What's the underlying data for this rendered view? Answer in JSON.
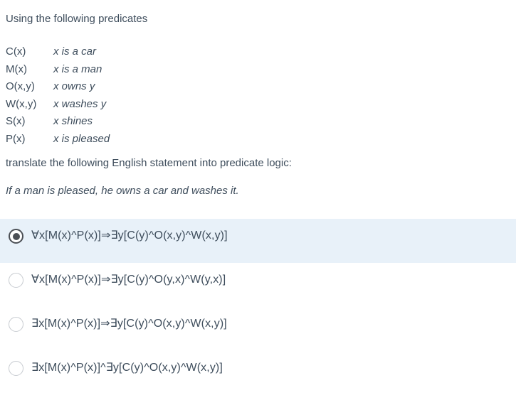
{
  "clipped_top_fragments": [
    "·",
    "·",
    "·",
    "·"
  ],
  "question": {
    "intro": "Using the following predicates",
    "instruction": "translate the following English statement into predicate logic:",
    "statement": "If a man is pleased, he owns a car and washes it."
  },
  "predicates": [
    {
      "symbol": "C(x)",
      "description": "x is a car"
    },
    {
      "symbol": "M(x)",
      "description": "x is a man"
    },
    {
      "symbol": "O(x,y)",
      "description": "x owns y"
    },
    {
      "symbol": "W(x,y)",
      "description": "x washes y"
    },
    {
      "symbol": "S(x)",
      "description": "x shines"
    },
    {
      "symbol": "P(x)",
      "description": "x is pleased"
    }
  ],
  "options": [
    {
      "text": "∀x[M(x)^P(x)]⇒∃y[C(y)^O(x,y)^W(x,y)]",
      "selected": true
    },
    {
      "text": "∀x[M(x)^P(x)]⇒∃y[C(y)^O(y,x)^W(y,x)]",
      "selected": false
    },
    {
      "text": "∃x[M(x)^P(x)]⇒∃y[C(y)^O(x,y)^W(x,y)]",
      "selected": false
    },
    {
      "text": "∃x[M(x)^P(x)]^∃y[C(y)^O(x,y)^W(x,y)]",
      "selected": false
    }
  ],
  "colors": {
    "page_background": "#ffffff",
    "text": "#3e4d5c",
    "selected_row_background": "#e8f1f9",
    "radio_unselected_border": "#c7cbd0",
    "radio_selected": "#4b4f55"
  }
}
